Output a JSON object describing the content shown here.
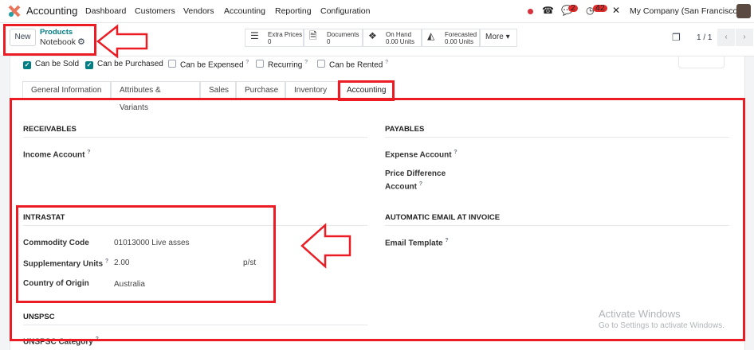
{
  "navbar": {
    "app": "Accounting",
    "menu": [
      "Dashboard",
      "Customers",
      "Vendors",
      "Accounting",
      "Reporting",
      "Configuration"
    ],
    "messages_count": "2",
    "activities_count": "42",
    "company": "My Company (San Francisco)"
  },
  "control": {
    "new_label": "New",
    "breadcrumb_parent": "Products",
    "record_name": "Notebook",
    "stats": [
      {
        "label": "Extra Prices",
        "value": "0"
      },
      {
        "label": "Documents",
        "value": "0"
      },
      {
        "label": "On Hand",
        "value": "0.00 Units"
      },
      {
        "label": "Forecasted",
        "value": "0.00 Units"
      }
    ],
    "more_label": "More",
    "pager": "1 / 1"
  },
  "checkboxes": [
    {
      "label": "Can be Sold",
      "checked": true
    },
    {
      "label": "Can be Purchased",
      "checked": true
    },
    {
      "label": "Can be Expensed",
      "checked": false
    },
    {
      "label": "Recurring",
      "checked": false
    },
    {
      "label": "Can be Rented",
      "checked": false
    }
  ],
  "tabs": [
    "General Information",
    "Attributes & Variants",
    "Sales",
    "Purchase",
    "Inventory",
    "Accounting"
  ],
  "active_tab": "Accounting",
  "receivables": {
    "title": "RECEIVABLES",
    "income_account": "Income Account"
  },
  "payables": {
    "title": "PAYABLES",
    "expense_account": "Expense Account",
    "price_diff_1": "Price Difference",
    "price_diff_2": "Account"
  },
  "intrastat": {
    "title": "INTRASTAT",
    "commodity_label": "Commodity Code",
    "commodity_value": "01013000 Live asses",
    "supp_label": "Supplementary Units",
    "supp_value": "2.00",
    "supp_unit": "p/st",
    "origin_label": "Country of Origin",
    "origin_value": "Australia"
  },
  "email": {
    "title": "AUTOMATIC EMAIL AT INVOICE",
    "template_label": "Email Template"
  },
  "unspsc": {
    "title": "UNSPSC",
    "category_label": "UNSPSC Category"
  },
  "watermark": {
    "line1": "Activate Windows",
    "line2": "Go to Settings to activate Windows."
  },
  "help_mark": "?"
}
